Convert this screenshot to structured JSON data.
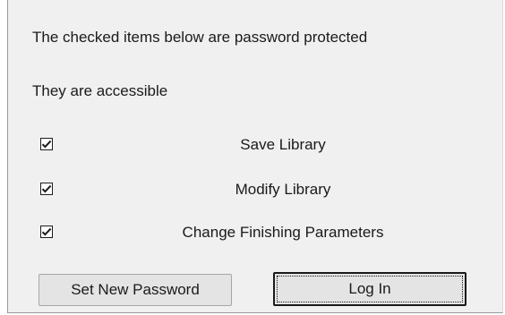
{
  "protection": {
    "header": "The checked items below are password protected",
    "status": "They are accessible",
    "items": [
      {
        "label": "Save Library",
        "checked": true
      },
      {
        "label": "Modify Library",
        "checked": true
      },
      {
        "label": "Change Finishing Parameters",
        "checked": true
      }
    ]
  },
  "buttons": {
    "set_password": "Set New Password",
    "log_in": "Log In"
  },
  "icons": {
    "check": "checkmark-icon"
  },
  "colors": {
    "panel_background": "#f0f0f0",
    "text": "#1a1a1a",
    "button_face": "#e4e4e4"
  }
}
